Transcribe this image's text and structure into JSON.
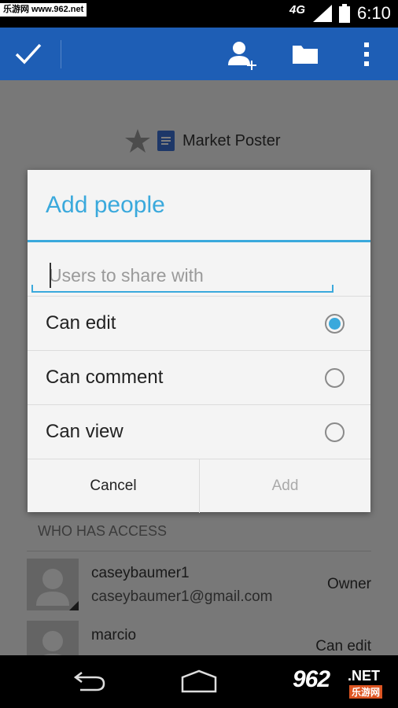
{
  "status_bar": {
    "watermark": "乐游网 www.962.net",
    "network": "4G",
    "time": "6:10"
  },
  "action_bar": {
    "icons": [
      "check-icon",
      "add-person-icon",
      "folder-icon",
      "overflow-icon"
    ]
  },
  "document": {
    "title": "Market Poster"
  },
  "dialog": {
    "title": "Add people",
    "input_placeholder": "Users to share with",
    "input_value": "",
    "options": [
      {
        "label": "Can edit",
        "selected": true
      },
      {
        "label": "Can comment",
        "selected": false
      },
      {
        "label": "Can view",
        "selected": false
      }
    ],
    "cancel_label": "Cancel",
    "add_label": "Add"
  },
  "access": {
    "header": "WHO HAS ACCESS",
    "people": [
      {
        "name": "caseybaumer1",
        "email": "caseybaumer1@gmail.com",
        "role": "Owner"
      },
      {
        "name": "marcio",
        "email": "",
        "role": "Can edit"
      }
    ]
  },
  "nav_logo": {
    "number": "962",
    "suffix": ".NET",
    "cn": "乐游网"
  },
  "colors": {
    "action_bar": "#1e5eb5",
    "accent": "#3aa9dc"
  }
}
